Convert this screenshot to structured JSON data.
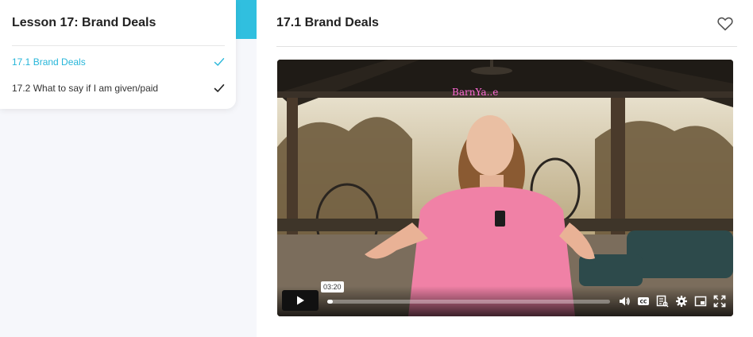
{
  "sidebar": {
    "title": "Lesson 17: Brand Deals",
    "items": [
      {
        "label": "17.1 Brand Deals",
        "state": "active",
        "icon": "check-icon",
        "color": "#27b6d9"
      },
      {
        "label": "17.2 What to say if I am given/paid",
        "state": "complete",
        "icon": "check-icon",
        "color": "#222222"
      }
    ]
  },
  "main": {
    "title": "17.1 Brand Deals",
    "favorite_icon": "heart-outline-icon"
  },
  "video": {
    "neon_sign": "BarnYa..e",
    "timestamp_tooltip": "03:20",
    "progress": 0.02,
    "controls": [
      "play-icon",
      "volume-icon",
      "cc-icon",
      "transcript-icon",
      "settings-icon",
      "picture-in-picture-icon",
      "fullscreen-icon"
    ]
  },
  "colors": {
    "accent": "#30bfdf",
    "active_link": "#27b6d9"
  }
}
